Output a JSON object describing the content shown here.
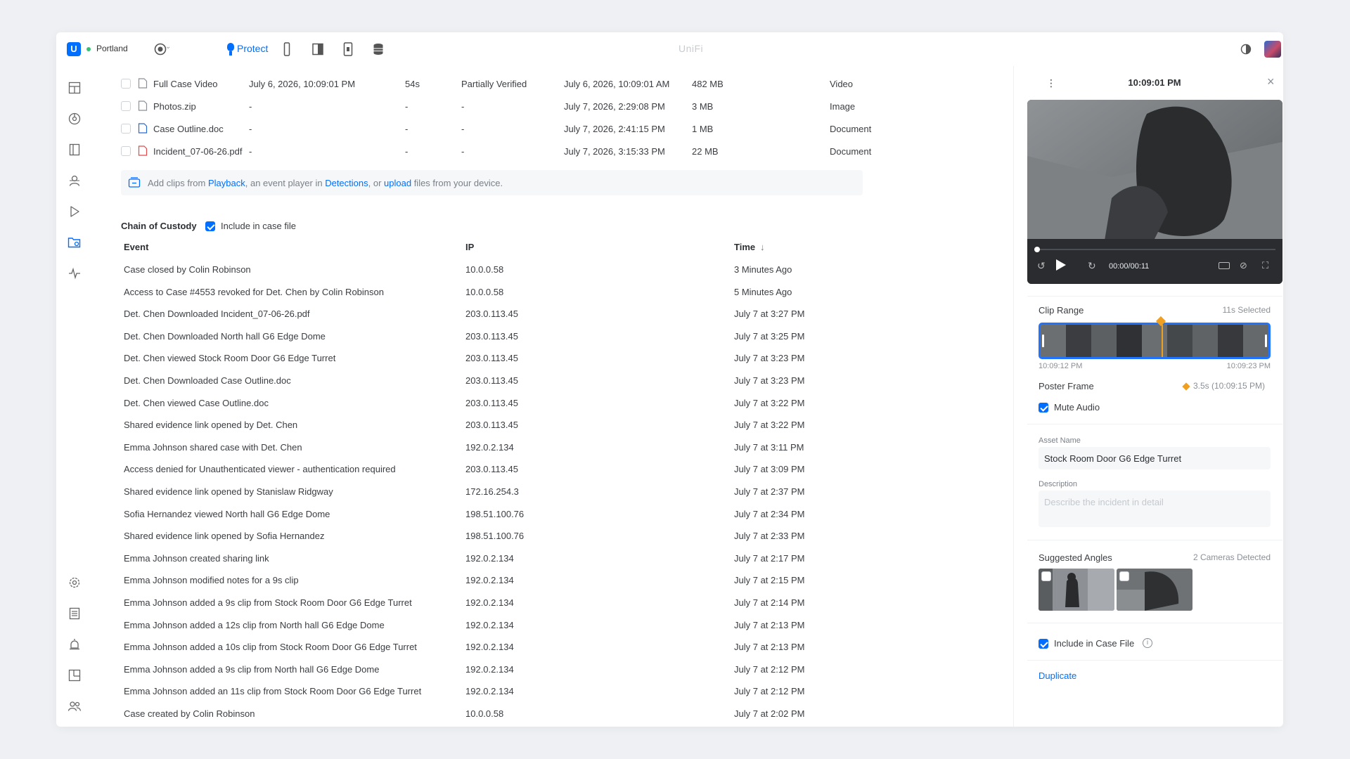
{
  "app": {
    "title": "UniFi",
    "site": "Portland",
    "protect_label": "Protect"
  },
  "files": [
    {
      "name": "Full Case Video",
      "date": "July 6, 2026, 10:09:01 PM",
      "duration": "54s",
      "status": "Partially Verified",
      "added": "July 6, 2026, 10:09:01 AM",
      "size": "482 MB",
      "type": "Video",
      "icon": "video-file-icon"
    },
    {
      "name": "Photos.zip",
      "date": "-",
      "duration": "-",
      "status": "-",
      "added": "July 7, 2026, 2:29:08 PM",
      "size": "3 MB",
      "type": "Image",
      "icon": "zip-file-icon"
    },
    {
      "name": "Case Outline.doc",
      "date": "-",
      "duration": "-",
      "status": "-",
      "added": "July 7, 2026, 2:41:15 PM",
      "size": "1 MB",
      "type": "Document",
      "icon": "doc-file-icon"
    },
    {
      "name": "Incident_07-06-26.pdf",
      "date": "-",
      "duration": "-",
      "status": "-",
      "added": "July 7, 2026, 3:15:33 PM",
      "size": "22 MB",
      "type": "Document",
      "icon": "pdf-file-icon"
    }
  ],
  "add_clips": {
    "prefix": "Add clips from ",
    "playback": "Playback",
    "middle": ", an event player in ",
    "detections": "Detections",
    "or": ", or ",
    "upload": "upload",
    "suffix": " files from your device."
  },
  "custody": {
    "title": "Chain of Custody",
    "include_label": "Include in case file",
    "include_checked": true,
    "headers": {
      "event": "Event",
      "ip": "IP",
      "time": "Time"
    },
    "sort_arrow": "↓",
    "rows": [
      {
        "event": "Case closed by Colin Robinson",
        "ip": "10.0.0.58",
        "time": "3 Minutes Ago"
      },
      {
        "event": "Access to Case #4553 revoked for Det. Chen by Colin Robinson",
        "ip": "10.0.0.58",
        "time": "5 Minutes Ago"
      },
      {
        "event": "Det. Chen Downloaded Incident_07-06-26.pdf",
        "ip": "203.0.113.45",
        "time": "July 7 at 3:27 PM"
      },
      {
        "event": "Det. Chen Downloaded North hall G6 Edge Dome",
        "ip": "203.0.113.45",
        "time": "July 7 at 3:25 PM"
      },
      {
        "event": "Det. Chen viewed Stock Room Door G6 Edge Turret",
        "ip": "203.0.113.45",
        "time": "July 7 at 3:23 PM"
      },
      {
        "event": "Det. Chen Downloaded Case Outline.doc",
        "ip": "203.0.113.45",
        "time": "July 7 at 3:23 PM"
      },
      {
        "event": "Det. Chen viewed Case Outline.doc",
        "ip": "203.0.113.45",
        "time": "July 7 at 3:22 PM"
      },
      {
        "event": "Shared evidence link opened by Det. Chen",
        "ip": "203.0.113.45",
        "time": "July 7 at 3:22 PM"
      },
      {
        "event": "Emma Johnson shared case with Det. Chen",
        "ip": "192.0.2.134",
        "time": "July 7 at 3:11 PM"
      },
      {
        "event": "Access denied for Unauthenticated viewer - authentication required",
        "ip": "203.0.113.45",
        "time": "July 7 at 3:09 PM"
      },
      {
        "event": "Shared evidence link opened by Stanislaw Ridgway",
        "ip": "172.16.254.3",
        "time": "July 7 at 2:37 PM"
      },
      {
        "event": "Sofia Hernandez viewed North hall G6 Edge Dome",
        "ip": "198.51.100.76",
        "time": "July 7 at 2:34 PM"
      },
      {
        "event": "Shared evidence link opened by Sofia Hernandez",
        "ip": "198.51.100.76",
        "time": "July 7 at 2:33 PM"
      },
      {
        "event": "Emma Johnson created sharing link",
        "ip": "192.0.2.134",
        "time": "July 7 at 2:17 PM"
      },
      {
        "event": "Emma Johnson modified notes for a 9s clip",
        "ip": "192.0.2.134",
        "time": "July 7 at 2:15 PM"
      },
      {
        "event": "Emma Johnson added a 9s clip from Stock Room Door G6 Edge Turret",
        "ip": "192.0.2.134",
        "time": "July 7 at 2:14 PM"
      },
      {
        "event": "Emma Johnson added a 12s clip from North hall G6 Edge Dome",
        "ip": "192.0.2.134",
        "time": "July 7 at 2:13 PM"
      },
      {
        "event": "Emma Johnson added a 10s clip from Stock Room Door G6 Edge Turret",
        "ip": "192.0.2.134",
        "time": "July 7 at 2:13 PM"
      },
      {
        "event": "Emma Johnson added a 9s clip from North hall G6 Edge Dome",
        "ip": "192.0.2.134",
        "time": "July 7 at 2:12 PM"
      },
      {
        "event": "Emma Johnson added an 11s clip from Stock Room Door G6 Edge Turret",
        "ip": "192.0.2.134",
        "time": "July 7 at 2:12 PM"
      },
      {
        "event": "Case created by Colin Robinson",
        "ip": "10.0.0.58",
        "time": "July 7 at 2:02 PM"
      }
    ]
  },
  "panel": {
    "timestamp": "10:09:01 PM",
    "player_time": "00:00/00:11",
    "clip_range_label": "Clip Range",
    "clip_selected": "11s Selected",
    "range_start": "10:09:12 PM",
    "range_end": "10:09:23 PM",
    "poster_label": "Poster Frame",
    "poster_value": "3.5s (10:09:15 PM)",
    "mute_label": "Mute Audio",
    "mute_checked": true,
    "asset_name_label": "Asset Name",
    "asset_name_value": "Stock Room Door G6 Edge Turret",
    "description_label": "Description",
    "description_placeholder": "Describe the incident in detail",
    "angles_label": "Suggested Angles",
    "angles_count": "2 Cameras Detected",
    "include_label": "Include in Case File",
    "include_checked": true,
    "duplicate_label": "Duplicate"
  },
  "colors": {
    "accent": "#006fff",
    "text": "#2c2f33",
    "muted": "#8b9097",
    "status_green": "#38c172",
    "poster_marker": "#f0a020"
  }
}
